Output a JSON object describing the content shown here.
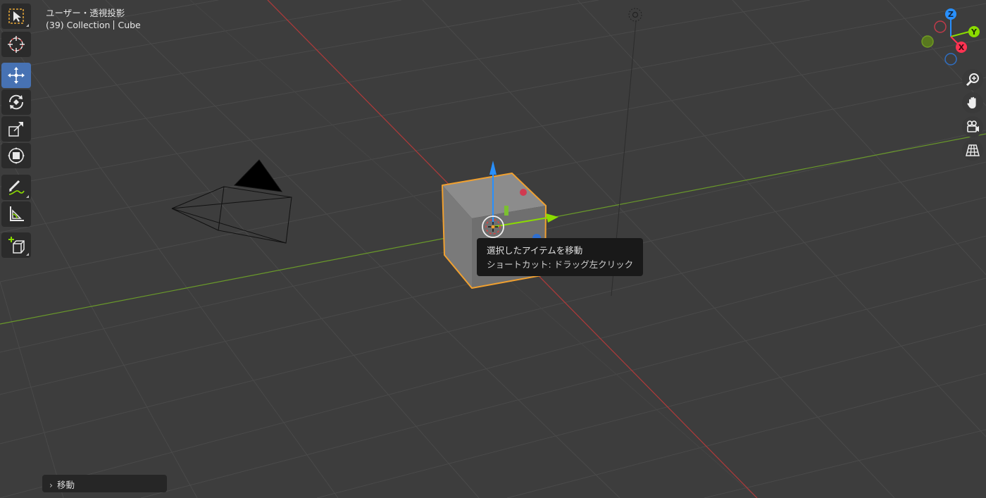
{
  "viewport": {
    "view_title": "ユーザー・透視投影",
    "object_info": {
      "collection": "(39) Collection",
      "object": "Cube"
    }
  },
  "toolbar": {
    "tools": [
      {
        "name": "select-box",
        "icon": "select-box-icon",
        "active": false
      },
      {
        "name": "cursor",
        "icon": "cursor-icon",
        "active": false
      },
      {
        "name": "move",
        "icon": "move-icon",
        "active": true
      },
      {
        "name": "rotate",
        "icon": "rotate-icon",
        "active": false
      },
      {
        "name": "scale",
        "icon": "scale-icon",
        "active": false
      },
      {
        "name": "transform",
        "icon": "transform-icon",
        "active": false
      },
      {
        "name": "annotate",
        "icon": "annotate-icon",
        "active": false
      },
      {
        "name": "measure",
        "icon": "measure-icon",
        "active": false
      },
      {
        "name": "add-cube",
        "icon": "add-cube-icon",
        "active": false
      }
    ]
  },
  "gizmo": {
    "z_label": "Z",
    "y_label": "Y",
    "x_label": "X",
    "colors": {
      "x": "#ff3352",
      "y": "#8bdc00",
      "z": "#2890ff"
    }
  },
  "nav_controls": [
    {
      "icon": "zoom-icon"
    },
    {
      "icon": "hand-pan-icon"
    },
    {
      "icon": "camera-view-icon"
    },
    {
      "icon": "grid-ortho-icon"
    }
  ],
  "tooltip": {
    "title": "選択したアイテムを移動",
    "shortcut": "ショートカット: ドラッグ左クリック"
  },
  "last_operator": {
    "label": "移動"
  },
  "colors": {
    "background": "#3d3d3d",
    "grid": "#4a4a4a",
    "x_axis": "#b03a3a",
    "y_axis": "#6a9a2a",
    "selection_outline": "#f0a030",
    "active_tool": "#4772b3"
  }
}
